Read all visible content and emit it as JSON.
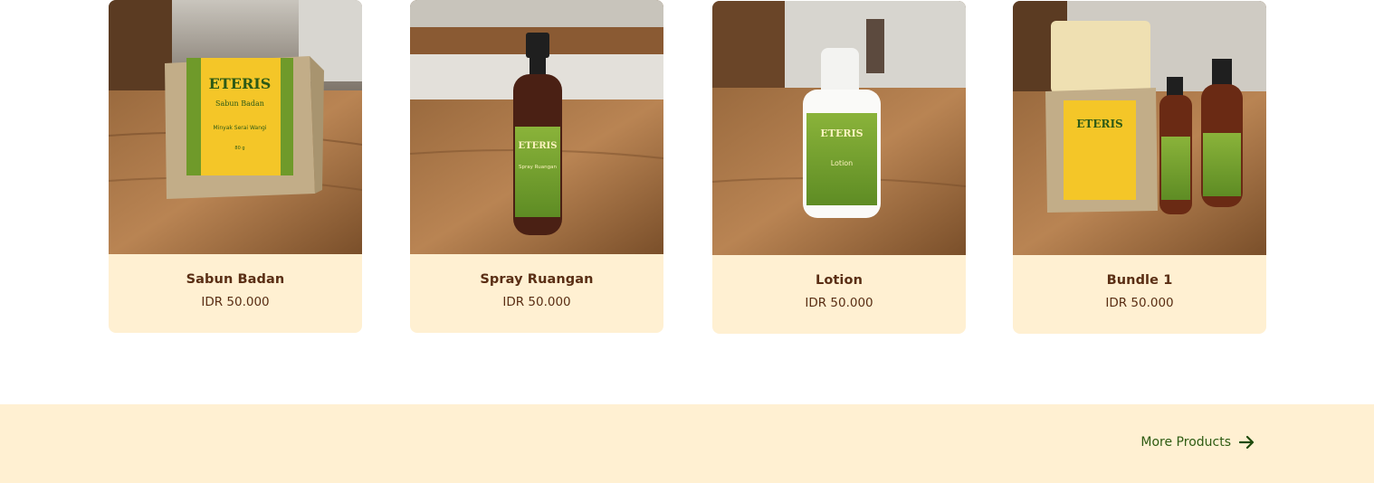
{
  "products": [
    {
      "name": "Sabun Badan",
      "price": "IDR 50.000",
      "image_icon": "soap-box-photo"
    },
    {
      "name": "Spray Ruangan",
      "price": "IDR 50.000",
      "image_icon": "spray-bottle-photo"
    },
    {
      "name": "Lotion",
      "price": "IDR 50.000",
      "image_icon": "lotion-bottle-photo"
    },
    {
      "name": "Bundle 1",
      "price": "IDR 50.000",
      "image_icon": "bundle-photo"
    }
  ],
  "footer": {
    "more_label": "More Products",
    "more_icon": "arrow-right-icon"
  },
  "colors": {
    "card_background": "#fff0d2",
    "product_text": "#5a2e14",
    "link_text": "#2e5b12"
  }
}
